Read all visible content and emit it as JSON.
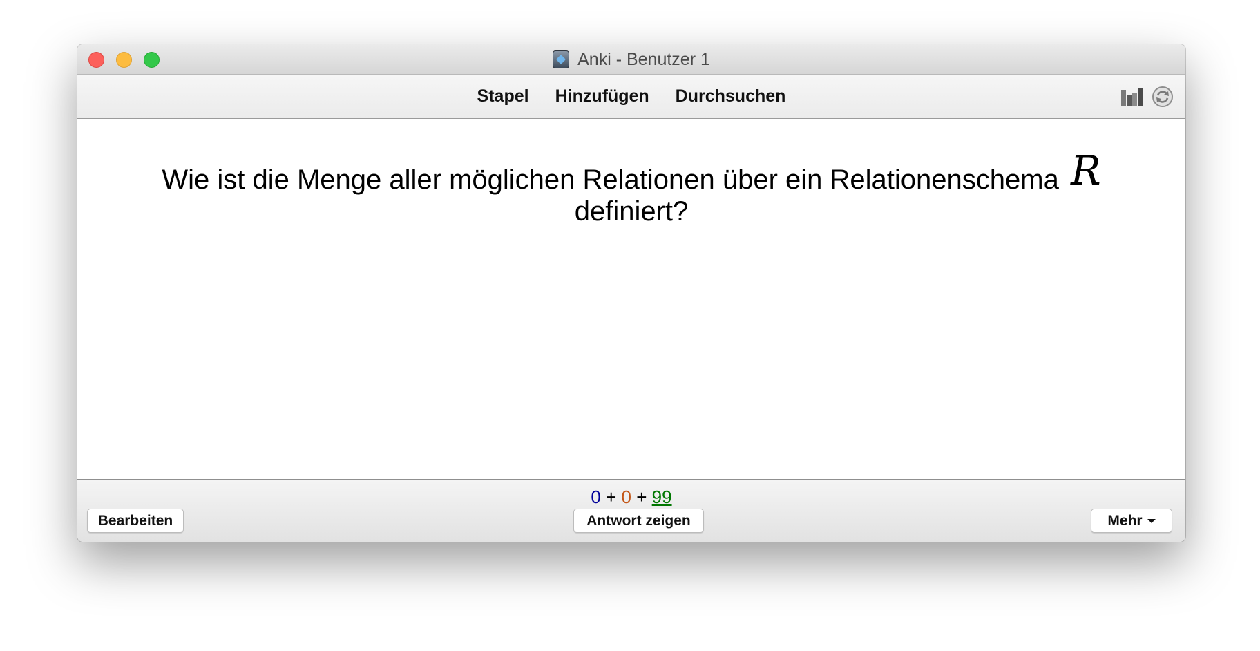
{
  "window": {
    "title": "Anki - Benutzer 1"
  },
  "toolbar": {
    "links": [
      "Stapel",
      "Hinzufügen",
      "Durchsuchen"
    ],
    "right_icons": [
      "stats-icon",
      "sync-icon"
    ]
  },
  "card": {
    "question_text": "Wie ist die Menge aller möglichen Relationen über ein Relationenschema",
    "math_symbol": "R",
    "question_end": "definiert?"
  },
  "bottom": {
    "counts": {
      "new": "0",
      "sep1": "+",
      "learning": "0",
      "sep2": "+",
      "review": "99"
    },
    "edit_label": "Bearbeiten",
    "answer_label": "Antwort zeigen",
    "more_label": "Mehr"
  },
  "colors": {
    "new_count": "#000099",
    "learning_count": "#c35617",
    "review_count": "#007700",
    "close": "#fc605b",
    "minimize": "#fdbc40",
    "maximize": "#34c84a"
  }
}
